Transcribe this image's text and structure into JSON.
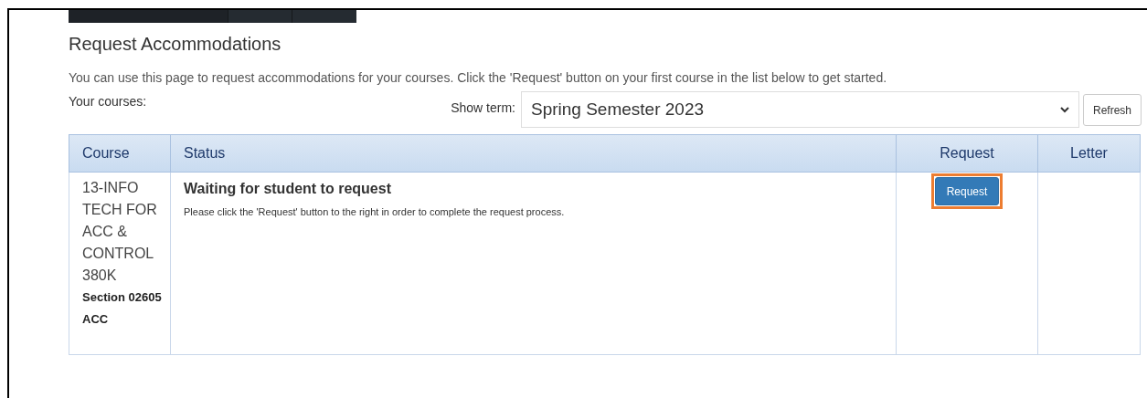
{
  "title": "Request Accommodations",
  "intro": "You can use this page to request accommodations for your courses. Click the 'Request' button on your first course in the list below to get started.",
  "courses_label": "Your courses:",
  "term_filter": {
    "label": "Show term:",
    "value": "Spring Semester 2023",
    "refresh_button": "Refresh"
  },
  "table": {
    "columns": [
      "Course",
      "Status",
      "Request",
      "Letter"
    ],
    "rows": [
      {
        "course": "13-INFO TECH FOR ACC & CONTROL 380K",
        "section": "Section 02605 ACC",
        "status": "Waiting for student to request",
        "status_note": "Please click the 'Request' button to the right in order to complete the request process.",
        "request_button": "Request",
        "highlighted": true
      }
    ]
  }
}
